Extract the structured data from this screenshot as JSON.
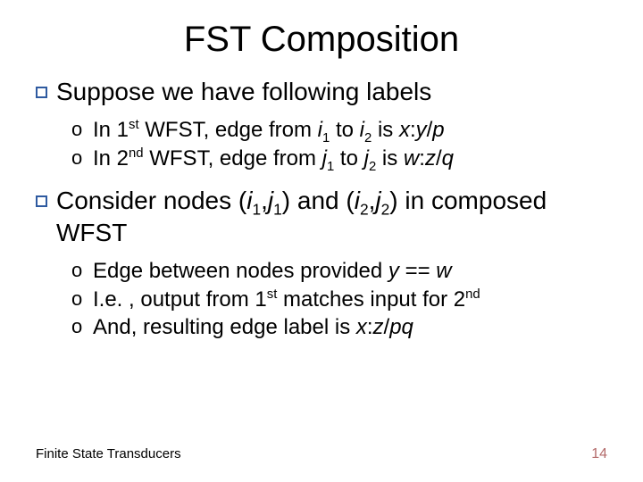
{
  "title": "FST Composition",
  "bullets": {
    "b1": {
      "text": "Suppose we have following labels",
      "subs": {
        "s1": {
          "pre": "In 1",
          "sup": "st",
          "mid1": " WFST, edge from ",
          "i1": "i",
          "sub1": "1",
          "mid2": " to ",
          "i2": "i",
          "sub2": "2",
          "mid3": " is ",
          "expr1": "x",
          "colon": ":",
          "expr2": "y",
          "slash": "/",
          "expr3": "p"
        },
        "s2": {
          "pre": "In 2",
          "sup": "nd",
          "mid1": " WFST, edge from ",
          "i1": "j",
          "sub1": "1",
          "mid2": " to ",
          "i2": "j",
          "sub2": "2",
          "mid3": " is ",
          "expr1": "w",
          "colon": ":",
          "expr2": "z",
          "slash": "/",
          "expr3": "q"
        }
      }
    },
    "b2": {
      "pre": "Consider nodes (",
      "n1a": "i",
      "n1as": "1",
      "comma1": ",",
      "n1b": "j",
      "n1bs": "1",
      "mid": ") and (",
      "n2a": "i",
      "n2as": "2",
      "comma2": ",",
      "n2b": "j",
      "n2bs": "2",
      "post": ") in composed WFST",
      "subs": {
        "s1": {
          "pre": "Edge between nodes provided ",
          "y": "y",
          "eq": " == ",
          "w": "w"
        },
        "s2": {
          "pre": "I.e. , output from 1",
          "sup1": "st",
          "mid": " matches input for 2",
          "sup2": "nd"
        },
        "s3": {
          "pre": "And, resulting edge label is ",
          "x": "x",
          "colon": ":",
          "z": "z",
          "slash": "/",
          "pq": "pq"
        }
      }
    }
  },
  "subMarker": "o",
  "footer": {
    "left": "Finite State Transducers",
    "right": "14"
  }
}
